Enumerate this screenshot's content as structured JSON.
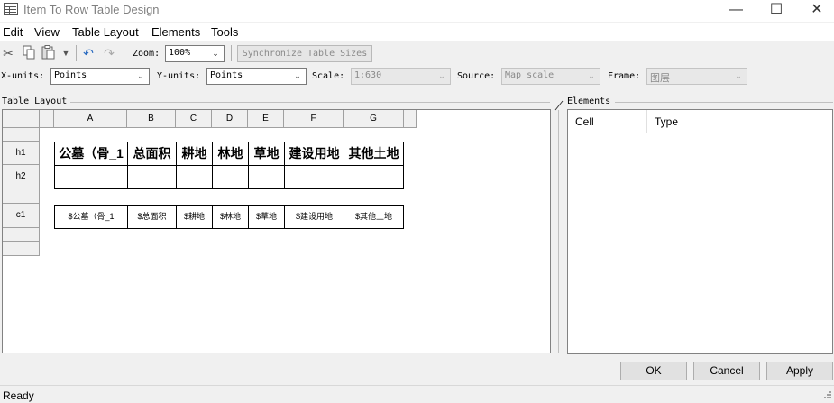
{
  "window": {
    "title": "Item To Row Table Design",
    "minimize": "—",
    "maximize": "☐",
    "close": "✕"
  },
  "menu": [
    "Edit",
    "View",
    "Table Layout",
    "Elements",
    "Tools"
  ],
  "toolbar": {
    "zoom_label": "Zoom:",
    "zoom_value": "100%",
    "sync_label": "Synchronize Table Sizes"
  },
  "units": {
    "x_label": "X-units:",
    "x_value": "Points",
    "y_label": "Y-units:",
    "y_value": "Points",
    "scale_label": "Scale:",
    "scale_value": "1:630",
    "source_label": "Source:",
    "source_value": "Map scale",
    "frame_label": "Frame:",
    "frame_value": "图层"
  },
  "table_layout": {
    "title": "Table Layout",
    "columns": [
      "A",
      "B",
      "C",
      "D",
      "E",
      "F",
      "G"
    ],
    "rows": [
      "h1",
      "h2",
      "c1"
    ],
    "header_cells": [
      "公墓（骨_1",
      "总面积",
      "耕地",
      "林地",
      "草地",
      "建设用地",
      "其他土地"
    ],
    "content_cells": [
      "$公墓（骨_1",
      "$总面积",
      "$耕地",
      "$林地",
      "$草地",
      "$建设用地",
      "$其他土地"
    ]
  },
  "elements": {
    "title": "Elements",
    "columns": [
      "Cell",
      "Type"
    ]
  },
  "buttons": {
    "ok": "OK",
    "cancel": "Cancel",
    "apply": "Apply"
  },
  "status": "Ready"
}
